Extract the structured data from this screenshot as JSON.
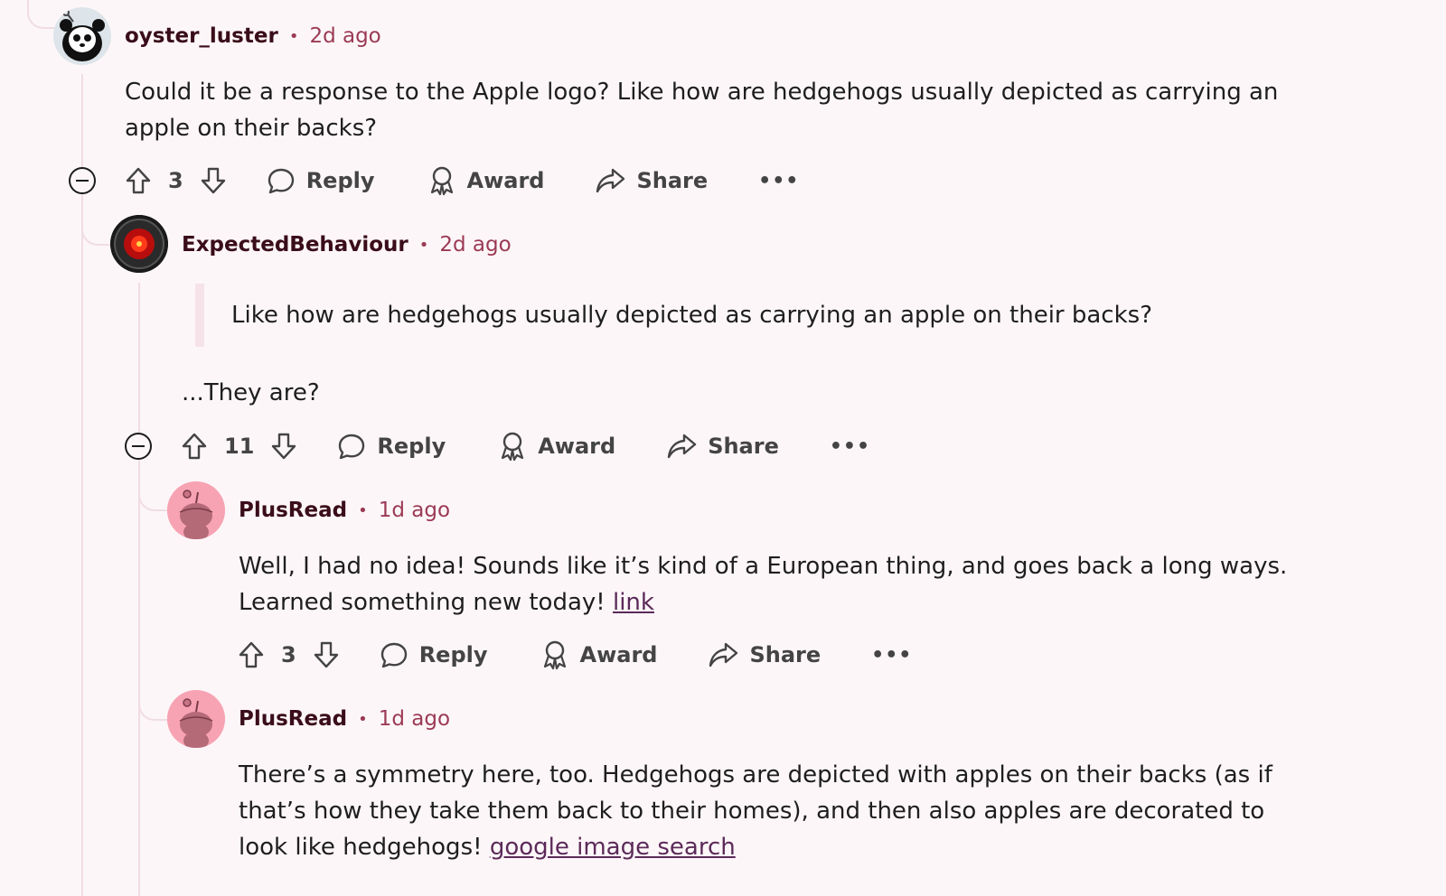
{
  "comments": [
    {
      "author": "oyster_luster",
      "time": "2d ago",
      "text": "Could it be a response to the Apple logo? Like how are hedgehogs usually depicted as carrying an apple on their backs?",
      "score": "3",
      "reply": "Reply",
      "award": "Award",
      "share": "Share",
      "more": "•••"
    },
    {
      "author": "ExpectedBehaviour",
      "time": "2d ago",
      "quote": "Like how are hedgehogs usually depicted as carrying an apple on their backs?",
      "text": "...They are?",
      "score": "11",
      "reply": "Reply",
      "award": "Award",
      "share": "Share",
      "more": "•••"
    },
    {
      "author": "PlusRead",
      "time": "1d ago",
      "text": "Well, I had no idea! Sounds like it’s kind of a European thing, and goes back a long ways. Learned something new today!",
      "link": "link",
      "score": "3",
      "reply": "Reply",
      "award": "Award",
      "share": "Share",
      "more": "•••"
    },
    {
      "author": "PlusRead",
      "time": "1d ago",
      "text": "There’s a symmetry here, too. Hedgehogs are depicted with apples on their backs (as if that’s how they take them back to their homes), and then also apples are decorated to look like hedgehogs!",
      "link": "google image search"
    }
  ],
  "separator": "•",
  "icons": [
    "upvote-icon",
    "downvote-icon",
    "reply-bubble-icon",
    "award-icon",
    "share-icon",
    "collapse-icon",
    "overflow-icon"
  ],
  "colors": {
    "background": "#fdf6f8",
    "author": "#3a0d1a",
    "meta": "#9b3a55",
    "link": "#5b2a59"
  }
}
